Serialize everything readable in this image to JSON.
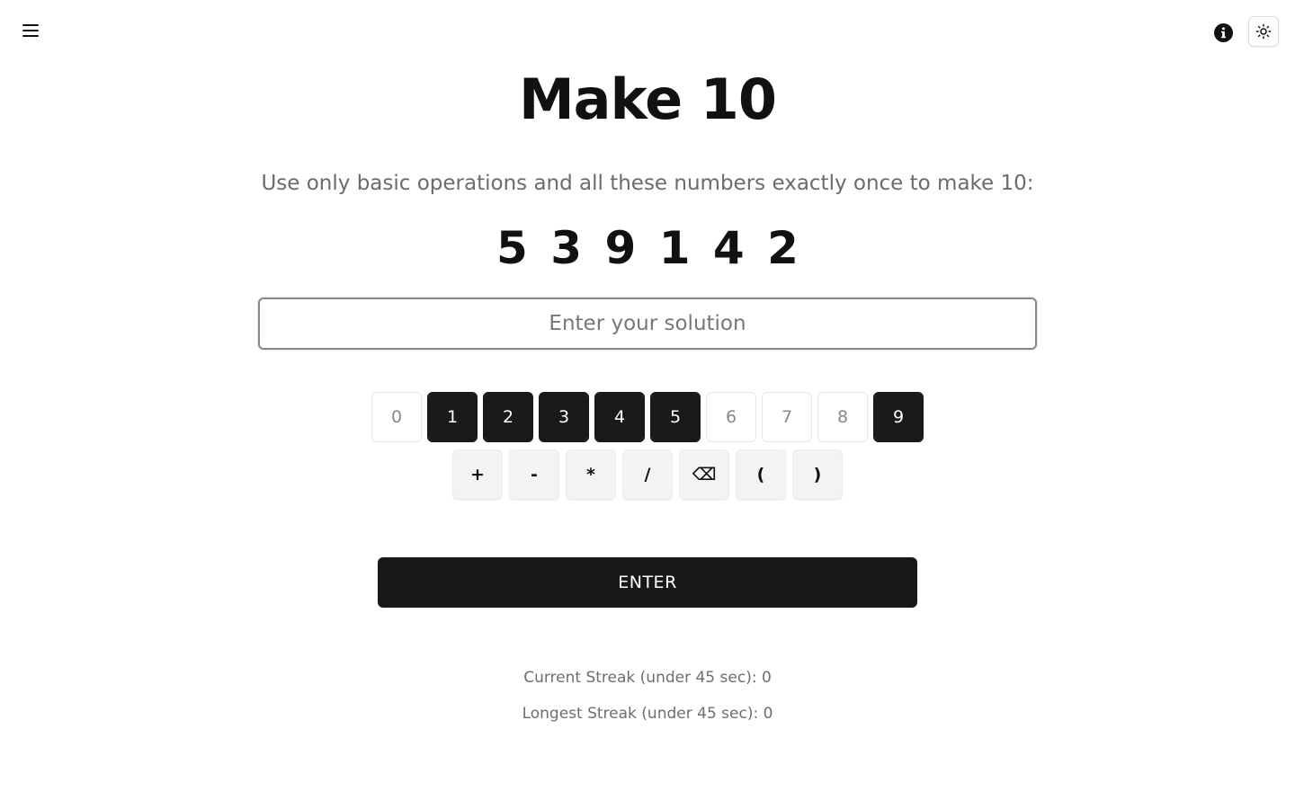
{
  "header": {
    "menu_icon": "hamburger-menu-icon",
    "info_icon": "info-circle-icon",
    "theme_icon": "sun-icon"
  },
  "main": {
    "title": "Make 10",
    "instructions": "Use only basic operations and all these numbers exactly once to make 10:",
    "numbers": [
      "5",
      "3",
      "9",
      "1",
      "4",
      "2"
    ],
    "solution_placeholder": "Enter your solution",
    "solution_value": ""
  },
  "keypad": {
    "digits": [
      {
        "label": "0",
        "active": false
      },
      {
        "label": "1",
        "active": true
      },
      {
        "label": "2",
        "active": true
      },
      {
        "label": "3",
        "active": true
      },
      {
        "label": "4",
        "active": true
      },
      {
        "label": "5",
        "active": true
      },
      {
        "label": "6",
        "active": false
      },
      {
        "label": "7",
        "active": false
      },
      {
        "label": "8",
        "active": false
      },
      {
        "label": "9",
        "active": true
      }
    ],
    "operators": [
      "+",
      "-",
      "*",
      "/",
      "⌫",
      "(",
      ")"
    ]
  },
  "enter_label": "ENTER",
  "stats": {
    "current_streak": "Current Streak (under 45 sec): 0",
    "longest_streak": "Longest Streak (under 45 sec): 0"
  },
  "colors": {
    "active_key": "#1a1a1a",
    "enter_button": "#181818",
    "muted_text": "#6b6b6b"
  }
}
